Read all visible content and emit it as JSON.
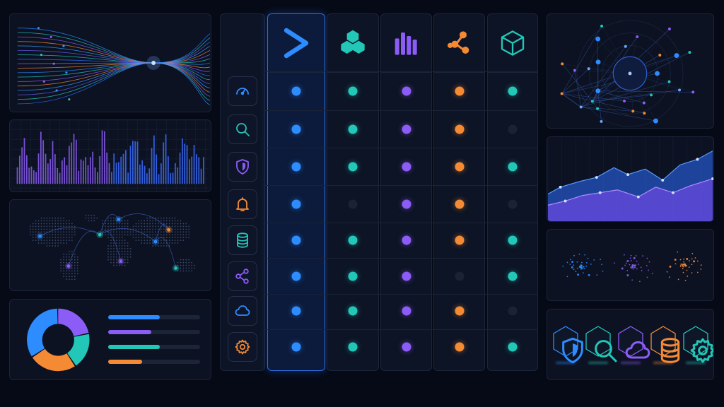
{
  "colors": {
    "blue": "#2d8cff",
    "teal": "#22c7b8",
    "purple": "#8c5cf6",
    "orange": "#f58a34",
    "off": "#1a2233"
  },
  "matrix": {
    "columns": [
      {
        "icon": "chevron-right-icon",
        "color": "#2d8cff",
        "active": true
      },
      {
        "icon": "cubes-icon",
        "color": "#22c7b8",
        "active": false
      },
      {
        "icon": "bars-icon",
        "color": "#8c5cf6",
        "active": false
      },
      {
        "icon": "nodes-icon",
        "color": "#f58a34",
        "active": false
      },
      {
        "icon": "cube-outline-icon",
        "color": "#22c7b8",
        "active": false
      }
    ],
    "rows": [
      {
        "icon": "gauge-icon",
        "color": "#2d8cff",
        "states": [
          1,
          1,
          1,
          1,
          1
        ]
      },
      {
        "icon": "search-icon",
        "color": "#22c7b8",
        "states": [
          1,
          1,
          1,
          1,
          0
        ]
      },
      {
        "icon": "shield-icon",
        "color": "#8c5cf6",
        "states": [
          1,
          1,
          1,
          1,
          1
        ]
      },
      {
        "icon": "bell-icon",
        "color": "#f58a34",
        "states": [
          1,
          0,
          1,
          1,
          0
        ]
      },
      {
        "icon": "database-icon",
        "color": "#22c7b8",
        "states": [
          1,
          1,
          1,
          1,
          1
        ]
      },
      {
        "icon": "share-icon",
        "color": "#8c5cf6",
        "states": [
          1,
          1,
          1,
          0,
          1
        ]
      },
      {
        "icon": "cloud-icon",
        "color": "#2d8cff",
        "states": [
          1,
          1,
          1,
          1,
          0
        ]
      },
      {
        "icon": "gear-icon",
        "color": "#f58a34",
        "states": [
          1,
          1,
          1,
          1,
          1
        ]
      }
    ]
  },
  "donut": {
    "segments": [
      {
        "color": "#8c5cf6",
        "value": 0.22
      },
      {
        "color": "#22c7b8",
        "value": 0.19
      },
      {
        "color": "#f58a34",
        "value": 0.25
      },
      {
        "color": "#2d8cff",
        "value": 0.34
      }
    ]
  },
  "progress_bars": [
    {
      "color": "#2d8cff",
      "value": 0.56
    },
    {
      "color": "#8c5cf6",
      "value": 0.47
    },
    {
      "color": "#22c7b8",
      "value": 0.56
    },
    {
      "color": "#f58a34",
      "value": 0.37
    }
  ],
  "hex_icons": [
    {
      "icon": "shield-icon",
      "color": "#2d8cff"
    },
    {
      "icon": "search-icon",
      "color": "#22c7b8"
    },
    {
      "icon": "cloud-icon",
      "color": "#8c5cf6"
    },
    {
      "icon": "database-icon",
      "color": "#f58a34"
    },
    {
      "icon": "gear-icon",
      "color": "#22c7b8"
    }
  ]
}
